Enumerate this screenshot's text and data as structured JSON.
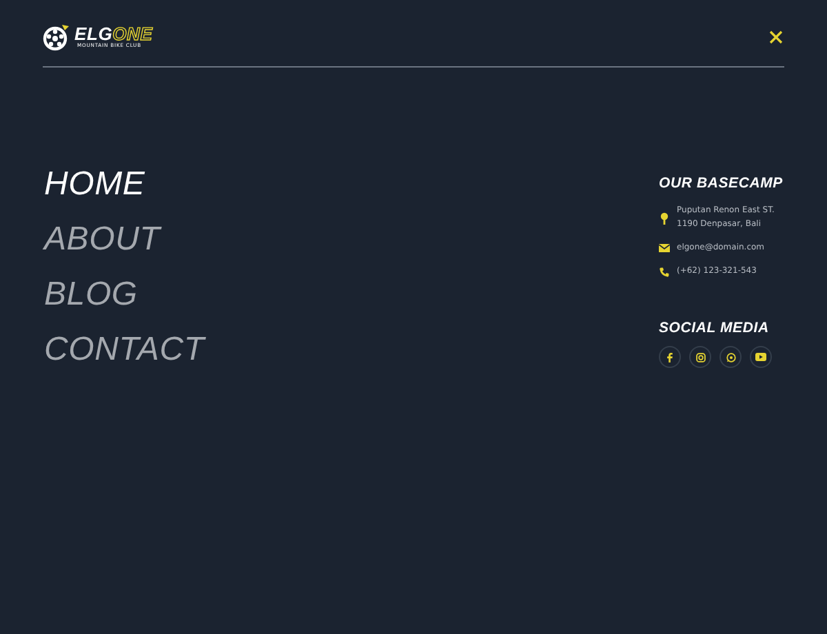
{
  "logo": {
    "name_start": "ELG",
    "name_end": "ONE",
    "tagline": "MOUNTAIN BIKE CLUB"
  },
  "menu": [
    {
      "label": "HOME",
      "selected": true
    },
    {
      "label": "ABOUT",
      "selected": false
    },
    {
      "label": "BLOG",
      "selected": false
    },
    {
      "label": "CONTACT",
      "selected": false
    }
  ],
  "basecamp": {
    "title": "OUR BASECAMP",
    "items": [
      {
        "kind": "address",
        "lines": [
          "Puputan Renon East ST.",
          "1190 Denpasar, Bali"
        ]
      },
      {
        "kind": "email",
        "lines": [
          "elgone@domain.com"
        ]
      },
      {
        "kind": "phone",
        "lines": [
          "(+62) 123-321-543"
        ]
      }
    ]
  },
  "social": {
    "title": "SOCIAL MEDIA",
    "links": [
      {
        "kind": "facebook"
      },
      {
        "kind": "instagram"
      },
      {
        "kind": "whatsapp"
      },
      {
        "kind": "youtube"
      }
    ]
  }
}
